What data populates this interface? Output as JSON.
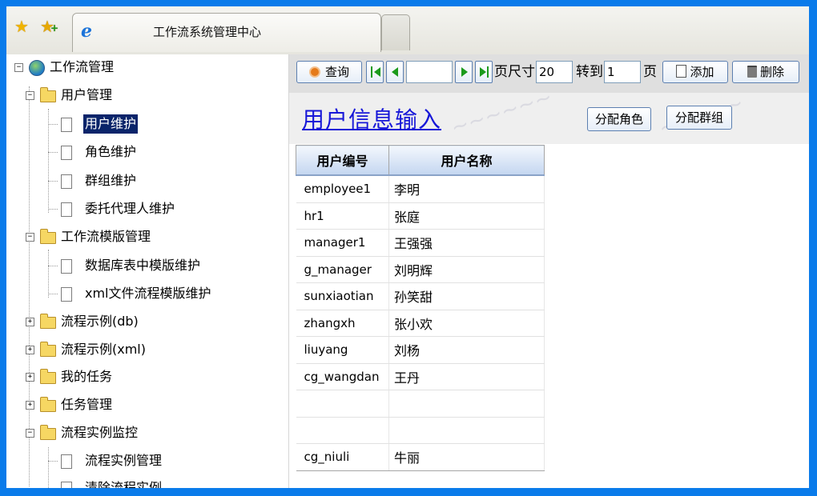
{
  "browser": {
    "tab_title": "工作流系统管理中心",
    "favorites_icon": "star-icon",
    "add_favorite_icon": "add-favorite-icon",
    "page_icon": "ie-icon"
  },
  "tree": {
    "root": "工作流管理",
    "user_mgmt": "用户管理",
    "user_maint": "用户维护",
    "role_maint": "角色维护",
    "group_maint": "群组维护",
    "delegate_maint": "委托代理人维护",
    "template_mgmt": "工作流模版管理",
    "db_template": "数据库表中模版维护",
    "xml_template": "xml文件流程模版维护",
    "example_db": "流程示例(db)",
    "example_xml": "流程示例(xml)",
    "my_tasks": "我的任务",
    "task_mgmt": "任务管理",
    "instance_monitor": "流程实例监控",
    "instance_mgmt": "流程实例管理",
    "instance_clear": "清除流程实例"
  },
  "toolbar": {
    "query": "查询",
    "page_input": "",
    "page_size_label": "页尺寸",
    "page_size": "20",
    "goto_label": "转到",
    "goto_page": "1",
    "page_suffix": "页",
    "add": "添加",
    "delete": "删除"
  },
  "form": {
    "title": "用户信息输入",
    "assign_role": "分配角色",
    "assign_group": "分配群组"
  },
  "table": {
    "headers": [
      "用户编号",
      "用户名称"
    ],
    "rows": [
      [
        "employee1",
        "李明"
      ],
      [
        "hr1",
        "张庭"
      ],
      [
        "manager1",
        "王强强"
      ],
      [
        "g_manager",
        "刘明辉"
      ],
      [
        "sunxiaotian",
        "孙笑甜"
      ],
      [
        "zhangxh",
        "张小欢"
      ],
      [
        "liuyang",
        "刘杨"
      ],
      [
        "cg_wangdan",
        "王丹"
      ],
      [
        "",
        ""
      ],
      [
        "",
        ""
      ],
      [
        "cg_niuli",
        "牛丽"
      ]
    ]
  }
}
